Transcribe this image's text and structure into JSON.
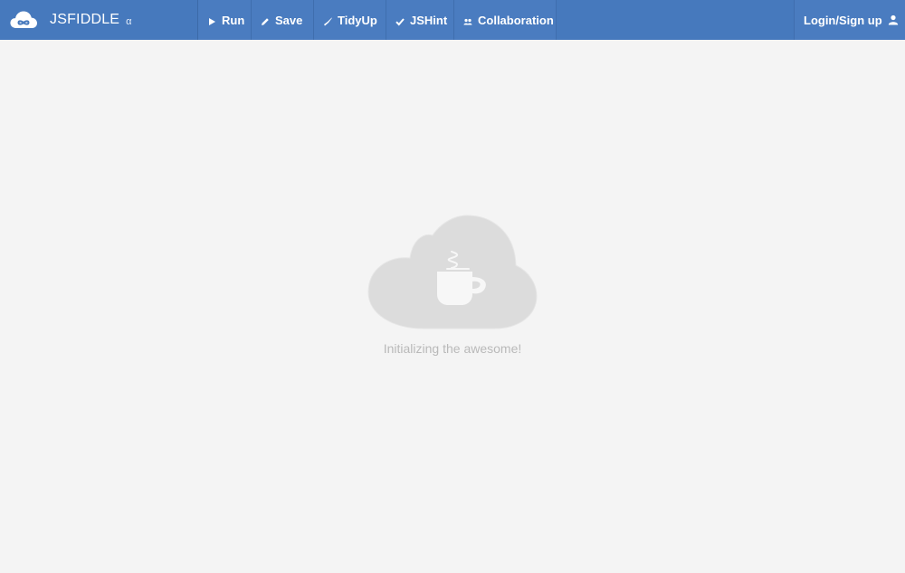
{
  "header": {
    "brand": {
      "title": "JSFIDDLE",
      "alpha": "α",
      "logo_icon": "cloud-infinity-icon"
    },
    "actions": [
      {
        "label": "Run",
        "icon": "play-icon"
      },
      {
        "label": "Save",
        "icon": "pencil-icon"
      },
      {
        "label": "TidyUp",
        "icon": "broom-icon"
      },
      {
        "label": "JSHint",
        "icon": "check-icon"
      },
      {
        "label": "Collaboration",
        "icon": "people-icon"
      }
    ],
    "login": {
      "label": "Login/Sign up",
      "icon": "user-icon"
    }
  },
  "loader": {
    "image_icon": "cloud-coffee-cup-icon",
    "message": "Initializing the awesome!"
  },
  "colors": {
    "header_bg": "#4679bd",
    "page_bg": "#f4f4f4",
    "cloud": "#dcdcdc",
    "message": "#b9b9b9"
  }
}
